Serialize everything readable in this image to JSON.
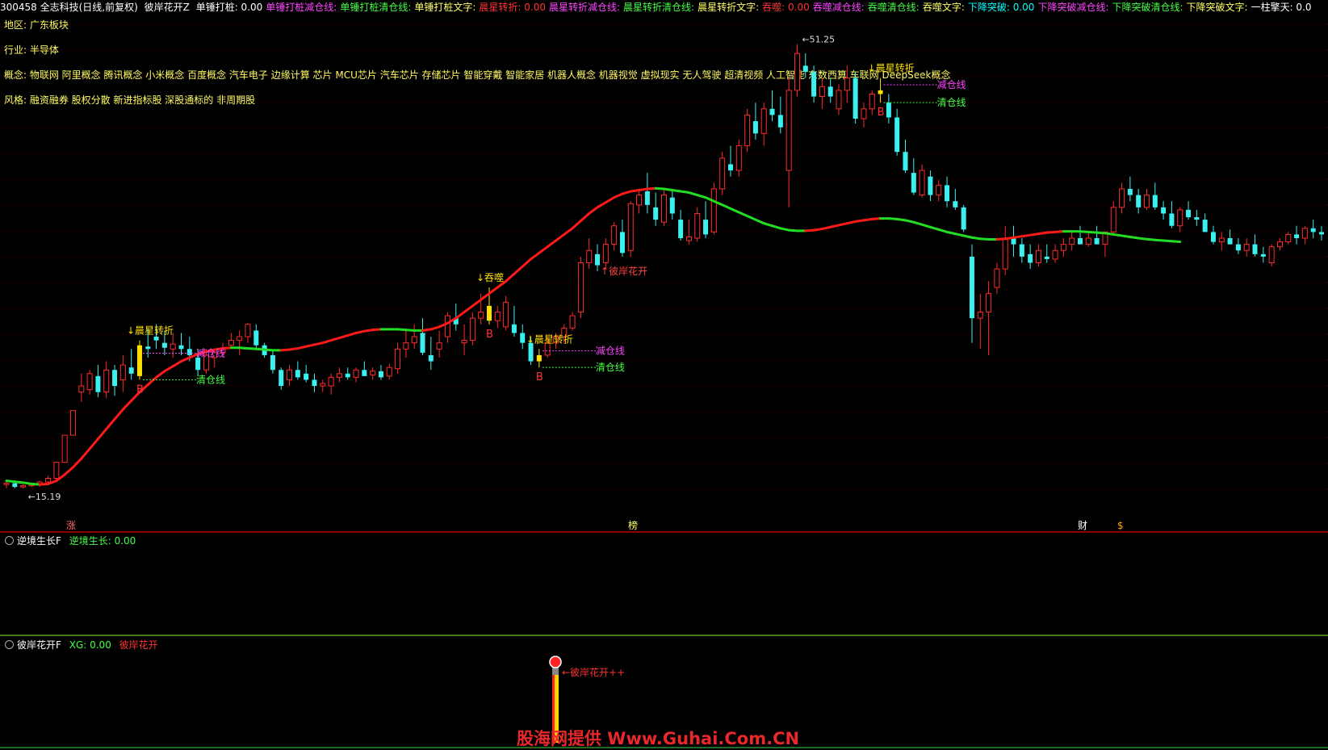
{
  "topbar": {
    "stock": "300458 全志科技(日线,前复权)",
    "indicator": "彼岸花开Z",
    "items": [
      {
        "label": "单锤打桩: 0.00",
        "color": "#ffffff"
      },
      {
        "label": "单锤打桩减仓线:",
        "color": "#ff44ff"
      },
      {
        "label": "单锤打桩清仓线:",
        "color": "#44ff44"
      },
      {
        "label": "单锤打桩文字:",
        "color": "#ffff66"
      },
      {
        "label": "晨星转折: 0.00",
        "color": "#ff3333"
      },
      {
        "label": "晨星转折减仓线:",
        "color": "#ff44ff"
      },
      {
        "label": "晨星转折清仓线:",
        "color": "#44ff44"
      },
      {
        "label": "晨星转折文字:",
        "color": "#ffff66"
      },
      {
        "label": "吞噬: 0.00",
        "color": "#ff3333"
      },
      {
        "label": "吞噬减仓线:",
        "color": "#ff44ff"
      },
      {
        "label": "吞噬清仓线:",
        "color": "#44ff44"
      },
      {
        "label": "吞噬文字:",
        "color": "#ffff66"
      },
      {
        "label": "下降突破: 0.00",
        "color": "#00ffff"
      },
      {
        "label": "下降突破减仓线:",
        "color": "#ff44ff"
      },
      {
        "label": "下降突破清仓线:",
        "color": "#44ff44"
      },
      {
        "label": "下降突破文字:",
        "color": "#ffff66"
      },
      {
        "label": "一柱擎天: 0.0",
        "color": "#ffffff"
      }
    ]
  },
  "info": {
    "region": "地区: 广东板块",
    "industry": "行业: 半导体",
    "concepts": "概念: 物联网 阿里概念 腾讯概念 小米概念 百度概念 汽车电子 边缘计算 芯片 MCU芯片 汽车芯片 存储芯片 智能穿戴 智能家居 机器人概念 机器视觉 虚拟现实 无人驾驶 超清视频 人工智能 东数西算 车联网 DeepSeek概念",
    "style": "风格: 融资融券 股权分散 新进指标股 深股通标的 非周期股"
  },
  "main_markers": {
    "high_label": "51.25",
    "low_label": "15.19",
    "bottom_tags": [
      {
        "text": "涨",
        "color": "#ff6666"
      },
      {
        "text": "榜",
        "color": "#ffff66"
      },
      {
        "text": "财",
        "color": "#ffffff"
      },
      {
        "text": "$",
        "color": "#ffaa00"
      }
    ]
  },
  "chart_data": {
    "type": "candlestick",
    "title": "",
    "ylim": [
      14,
      53
    ],
    "candles": [
      [
        15.5,
        15.8,
        15.2,
        15.6
      ],
      [
        15.6,
        15.7,
        15.2,
        15.3
      ],
      [
        15.3,
        15.5,
        15.19,
        15.4
      ],
      [
        15.4,
        15.6,
        15.3,
        15.5
      ],
      [
        15.5,
        15.8,
        15.3,
        15.7
      ],
      [
        15.7,
        16.2,
        15.5,
        16.0
      ],
      [
        16.0,
        17.3,
        15.9,
        17.3
      ],
      [
        17.3,
        19.5,
        17.3,
        19.5
      ],
      [
        19.5,
        21.5,
        19.5,
        21.5
      ],
      [
        23.0,
        24.5,
        22.2,
        23.5
      ],
      [
        23.2,
        24.8,
        22.8,
        24.5
      ],
      [
        24.3,
        25.2,
        22.6,
        23.0
      ],
      [
        23.0,
        25.5,
        22.5,
        24.8
      ],
      [
        24.8,
        25.2,
        22.7,
        23.5
      ],
      [
        24.0,
        26.0,
        23.0,
        25.2
      ],
      [
        25.0,
        26.5,
        24.0,
        24.5
      ],
      [
        24.3,
        27.2,
        24.0,
        26.8
      ],
      [
        26.7,
        28.2,
        25.8,
        26.5
      ],
      [
        27.5,
        28.5,
        26.5,
        27.2
      ],
      [
        27.0,
        28.0,
        26.0,
        26.6
      ],
      [
        26.5,
        27.8,
        25.8,
        26.9
      ],
      [
        26.8,
        27.8,
        26.0,
        26.5
      ],
      [
        26.5,
        27.5,
        25.5,
        26.0
      ],
      [
        25.8,
        26.5,
        24.3,
        24.8
      ],
      [
        24.8,
        26.5,
        24.5,
        26.0
      ],
      [
        25.8,
        26.5,
        25.0,
        26.2
      ],
      [
        26.2,
        27.0,
        25.8,
        26.5
      ],
      [
        26.8,
        27.8,
        26.5,
        27.2
      ],
      [
        27.2,
        28.0,
        26.0,
        27.5
      ],
      [
        27.5,
        28.6,
        27.0,
        28.5
      ],
      [
        28.0,
        28.5,
        26.5,
        26.8
      ],
      [
        26.8,
        27.0,
        25.8,
        26.0
      ],
      [
        26.0,
        26.5,
        24.5,
        24.8
      ],
      [
        24.8,
        25.0,
        23.2,
        23.5
      ],
      [
        24.0,
        25.2,
        23.5,
        24.8
      ],
      [
        24.8,
        25.5,
        24.0,
        24.2
      ],
      [
        24.5,
        25.2,
        23.8,
        24.0
      ],
      [
        24.0,
        24.5,
        23.0,
        23.5
      ],
      [
        23.5,
        24.0,
        23.0,
        23.7
      ],
      [
        23.5,
        24.5,
        22.8,
        24.2
      ],
      [
        24.2,
        25.0,
        23.8,
        24.5
      ],
      [
        24.5,
        25.0,
        24.0,
        24.2
      ],
      [
        24.2,
        25.0,
        23.8,
        24.8
      ],
      [
        24.8,
        25.5,
        24.3,
        24.3
      ],
      [
        24.4,
        25.0,
        24.0,
        24.7
      ],
      [
        24.7,
        25.2,
        24.0,
        24.2
      ],
      [
        24.3,
        25.3,
        24.0,
        25.0
      ],
      [
        24.9,
        27.0,
        24.5,
        26.5
      ],
      [
        26.5,
        28.0,
        25.8,
        27.0
      ],
      [
        27.0,
        28.5,
        26.5,
        27.5
      ],
      [
        27.8,
        29.0,
        26.0,
        26.2
      ],
      [
        26.0,
        27.5,
        24.8,
        25.5
      ],
      [
        26.5,
        28.0,
        25.8,
        27.0
      ],
      [
        27.5,
        29.5,
        27.0,
        29.2
      ],
      [
        29.0,
        30.2,
        28.0,
        28.5
      ],
      [
        27.0,
        28.5,
        26.0,
        27.2
      ],
      [
        27.2,
        29.5,
        26.8,
        29.0
      ],
      [
        29.0,
        31.0,
        28.5,
        29.5
      ],
      [
        30.0,
        31.5,
        28.5,
        28.8
      ],
      [
        28.8,
        30.0,
        28.2,
        29.5
      ],
      [
        28.3,
        30.8,
        28.0,
        30.3
      ],
      [
        28.5,
        30.0,
        27.5,
        27.8
      ],
      [
        27.8,
        28.5,
        26.5,
        27.0
      ],
      [
        27.0,
        27.5,
        25.2,
        25.5
      ],
      [
        25.5,
        26.5,
        25.0,
        26.0
      ],
      [
        26.0,
        27.5,
        25.8,
        27.0
      ],
      [
        27.0,
        27.8,
        26.5,
        27.5
      ],
      [
        27.5,
        28.5,
        27.0,
        28.2
      ],
      [
        28.2,
        29.5,
        28.0,
        29.2
      ],
      [
        29.5,
        34.0,
        29.0,
        33.5
      ],
      [
        33.5,
        35.5,
        33.0,
        34.5
      ],
      [
        34.2,
        35.0,
        32.8,
        33.3
      ],
      [
        33.5,
        35.5,
        33.0,
        35.0
      ],
      [
        35.0,
        36.8,
        34.5,
        36.5
      ],
      [
        36.0,
        37.0,
        34.0,
        34.3
      ],
      [
        34.5,
        38.5,
        34.0,
        38.3
      ],
      [
        38.2,
        39.5,
        37.5,
        39.0
      ],
      [
        39.3,
        40.8,
        37.5,
        38.2
      ],
      [
        38.0,
        39.2,
        36.5,
        37.0
      ],
      [
        36.8,
        39.5,
        36.5,
        39.0
      ],
      [
        38.8,
        39.5,
        37.0,
        37.5
      ],
      [
        37.0,
        37.8,
        35.3,
        35.5
      ],
      [
        35.3,
        37.0,
        35.0,
        35.6
      ],
      [
        35.5,
        38.0,
        35.2,
        37.5
      ],
      [
        37.0,
        38.5,
        35.5,
        35.8
      ],
      [
        36.0,
        40.0,
        35.8,
        39.5
      ],
      [
        39.5,
        42.5,
        39.0,
        42.0
      ],
      [
        41.5,
        43.0,
        40.5,
        41.0
      ],
      [
        41.0,
        43.5,
        40.5,
        43.0
      ],
      [
        43.0,
        46.0,
        42.5,
        45.5
      ],
      [
        45.0,
        46.5,
        43.5,
        44.0
      ],
      [
        44.0,
        46.5,
        43.0,
        46.0
      ],
      [
        46.0,
        47.5,
        45.0,
        45.5
      ],
      [
        45.5,
        47.0,
        44.0,
        44.5
      ],
      [
        41.0,
        48.5,
        38.0,
        47.5
      ],
      [
        47.5,
        51.25,
        47.0,
        50.5
      ],
      [
        49.5,
        50.5,
        48.5,
        49.0
      ],
      [
        49.0,
        49.5,
        46.5,
        47.0
      ],
      [
        47.0,
        48.5,
        46.0,
        47.8
      ],
      [
        47.8,
        48.5,
        46.5,
        47.0
      ],
      [
        46.0,
        48.0,
        45.5,
        47.5
      ],
      [
        47.5,
        49.5,
        46.5,
        48.5
      ],
      [
        48.5,
        49.0,
        44.8,
        45.2
      ],
      [
        45.2,
        46.5,
        44.5,
        46.0
      ],
      [
        46.0,
        47.5,
        45.5,
        47.2
      ],
      [
        47.2,
        48.5,
        46.5,
        47.5
      ],
      [
        46.5,
        47.2,
        44.8,
        45.3
      ],
      [
        45.3,
        46.0,
        42.2,
        42.5
      ],
      [
        42.5,
        43.5,
        40.8,
        41.0
      ],
      [
        40.8,
        42.0,
        39.0,
        39.2
      ],
      [
        39.0,
        41.5,
        38.8,
        41.0
      ],
      [
        40.5,
        41.0,
        38.5,
        39.0
      ],
      [
        39.0,
        40.2,
        38.5,
        39.8
      ],
      [
        39.8,
        40.5,
        38.0,
        38.5
      ],
      [
        38.5,
        39.5,
        37.8,
        38.0
      ],
      [
        38.0,
        38.2,
        36.0,
        36.2
      ],
      [
        34.0,
        35.0,
        27.0,
        29.0
      ],
      [
        29.0,
        31.0,
        26.5,
        29.5
      ],
      [
        29.5,
        32.0,
        26.0,
        31.0
      ],
      [
        31.5,
        33.5,
        31.0,
        33.0
      ],
      [
        33.0,
        36.5,
        32.5,
        35.5
      ],
      [
        35.5,
        36.5,
        34.0,
        35.0
      ],
      [
        35.0,
        35.5,
        33.5,
        34.0
      ],
      [
        34.2,
        35.0,
        33.0,
        33.5
      ],
      [
        33.5,
        35.0,
        33.2,
        34.5
      ],
      [
        34.0,
        35.0,
        33.5,
        33.8
      ],
      [
        33.8,
        35.0,
        33.5,
        34.5
      ],
      [
        34.5,
        35.5,
        34.0,
        35.0
      ],
      [
        35.0,
        36.0,
        34.5,
        35.5
      ],
      [
        35.5,
        36.5,
        35.0,
        35.0
      ],
      [
        35.0,
        36.0,
        34.8,
        35.5
      ],
      [
        35.5,
        36.5,
        35.0,
        35.0
      ],
      [
        35.0,
        36.0,
        34.0,
        36.0
      ],
      [
        36.0,
        38.5,
        35.8,
        38.0
      ],
      [
        38.0,
        40.0,
        37.5,
        39.5
      ],
      [
        39.5,
        40.5,
        38.5,
        39.0
      ],
      [
        39.0,
        39.5,
        37.5,
        38.0
      ],
      [
        38.0,
        39.5,
        37.8,
        39.0
      ],
      [
        39.0,
        40.0,
        37.8,
        38.0
      ],
      [
        38.0,
        38.5,
        37.0,
        37.5
      ],
      [
        37.5,
        38.5,
        36.3,
        36.5
      ],
      [
        36.5,
        38.0,
        36.0,
        37.8
      ],
      [
        37.8,
        38.5,
        37.0,
        37.2
      ],
      [
        37.2,
        37.8,
        36.5,
        37.0
      ],
      [
        37.0,
        37.5,
        36.0,
        36.0
      ],
      [
        36.0,
        36.5,
        35.0,
        35.2
      ],
      [
        35.2,
        36.0,
        34.5,
        35.5
      ],
      [
        35.5,
        36.2,
        35.0,
        35.0
      ],
      [
        35.0,
        35.5,
        34.2,
        34.5
      ],
      [
        34.5,
        35.5,
        34.0,
        35.0
      ],
      [
        35.0,
        35.8,
        34.0,
        34.2
      ],
      [
        34.2,
        34.8,
        33.5,
        34.0
      ],
      [
        33.5,
        35.0,
        33.2,
        34.8
      ],
      [
        34.8,
        35.5,
        34.5,
        35.2
      ],
      [
        35.2,
        36.0,
        35.0,
        35.8
      ],
      [
        35.8,
        36.5,
        35.0,
        35.5
      ],
      [
        35.5,
        36.5,
        35.0,
        36.3
      ],
      [
        36.3,
        37.0,
        35.5,
        36.0
      ],
      [
        36.0,
        36.5,
        35.3,
        35.8
      ]
    ],
    "ma_line": [
      15.8,
      15.72,
      15.65,
      15.55,
      15.5,
      15.55,
      15.8,
      16.3,
      16.9,
      17.6,
      18.4,
      19.2,
      20.0,
      20.8,
      21.6,
      22.3,
      23.0,
      23.6,
      24.2,
      24.7,
      25.1,
      25.5,
      25.8,
      26.1,
      26.3,
      26.45,
      26.55,
      26.6,
      26.6,
      26.55,
      26.5,
      26.45,
      26.4,
      26.4,
      26.45,
      26.55,
      26.7,
      26.85,
      27.0,
      27.2,
      27.4,
      27.6,
      27.8,
      27.95,
      28.05,
      28.1,
      28.1,
      28.1,
      28.05,
      28.0,
      28.0,
      28.1,
      28.3,
      28.6,
      29.0,
      29.5,
      30.0,
      30.5,
      31.0,
      31.5,
      32.0,
      32.6,
      33.2,
      33.8,
      34.3,
      34.8,
      35.3,
      35.8,
      36.3,
      36.9,
      37.5,
      38.0,
      38.4,
      38.8,
      39.1,
      39.3,
      39.4,
      39.5,
      39.55,
      39.5,
      39.4,
      39.3,
      39.2,
      39.0,
      38.8,
      38.5,
      38.2,
      37.9,
      37.6,
      37.3,
      37.0,
      36.7,
      36.5,
      36.3,
      36.15,
      36.1,
      36.1,
      36.15,
      36.25,
      36.4,
      36.55,
      36.7,
      36.85,
      36.95,
      37.05,
      37.1,
      37.1,
      37.05,
      36.95,
      36.8,
      36.6,
      36.4,
      36.2,
      36.0,
      35.85,
      35.7,
      35.55,
      35.45,
      35.4,
      35.4,
      35.45,
      35.55,
      35.65,
      35.75,
      35.85,
      35.95,
      36.0,
      36.05,
      36.05,
      36.05,
      36.0,
      35.95,
      35.9,
      35.8,
      35.7,
      35.6,
      35.5,
      35.42,
      35.35,
      35.3,
      35.25,
      35.2
    ],
    "ma_colors": "green when falling/flat, red when rising",
    "signals": [
      {
        "index": 16,
        "label": "晨星转折",
        "buy": "B",
        "reduce": "减仓线",
        "clear": "清仓线"
      },
      {
        "index": 58,
        "label": "吞噬",
        "buy": "B"
      },
      {
        "index": 64,
        "label": "晨星转折",
        "buy": "B",
        "reduce": "减仓线",
        "clear": "清仓线"
      },
      {
        "index": 71,
        "label": "彼岸花开"
      },
      {
        "index": 105,
        "label": "晨星转折",
        "buy": "B",
        "reduce": "减仓线",
        "clear": "清仓线"
      }
    ]
  },
  "panel2": {
    "title": "逆境生长F",
    "value": "逆境生长: 0.00"
  },
  "panel3": {
    "title": "彼岸花开F",
    "value": "XG: 0.00",
    "flag": "彼岸花开",
    "signal_label": "彼岸花开++"
  },
  "watermark": "股海网提供 Www.Guhai.Com.CN",
  "colors": {
    "up": "#ff2a2a",
    "down": "#3cf0f0",
    "highlight": "#ffe000",
    "ma_up": "#ff1a1a",
    "ma_down": "#22dd22",
    "reduce": "#ff44ff",
    "clear": "#44ff44"
  }
}
